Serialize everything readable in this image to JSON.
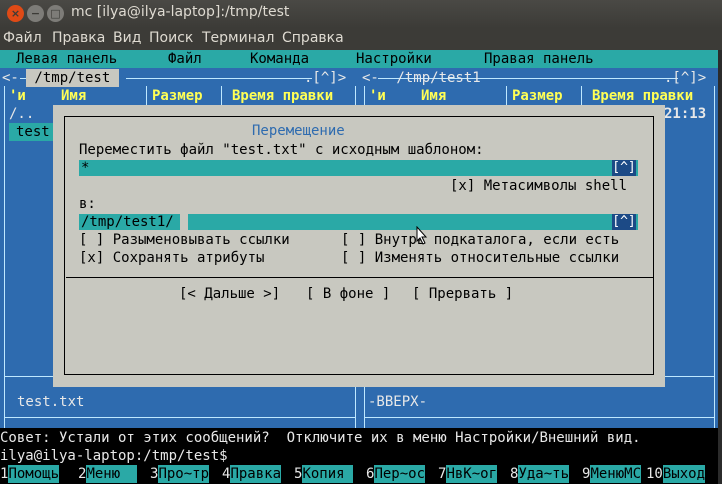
{
  "window": {
    "title": "mc [ilya@ilya-laptop]:/tmp/test"
  },
  "gnome_menu": [
    "Файл",
    "Правка",
    "Вид",
    "Поиск",
    "Терминал",
    "Справка"
  ],
  "mc_menu": [
    "Левая панель",
    "Файл",
    "Команда",
    "Настройки",
    "Правая панель"
  ],
  "left_panel": {
    "path": " /tmp/test ",
    "arrows_left": "<-",
    "arrows_right": ".[^]>",
    "col_sort": "'и",
    "col_name": "Имя",
    "col_size": "Размер",
    "col_time": "Время правки",
    "row1": "/..",
    "row2": "test",
    "footer": "test.txt"
  },
  "right_panel": {
    "path": " /tmp/test1 ",
    "arrows_left": "<-",
    "arrows_right": ".[^]>",
    "col_sort": "'и",
    "col_name": "Имя",
    "col_size": "Размер",
    "col_time": "Время правки",
    "row1_time": "21:13",
    "footer": "-ВВЕРХ-"
  },
  "dialog": {
    "title": "Перемещение",
    "prompt": "Переместить файл \"test.txt\" с исходным шаблоном:",
    "source_value": "*",
    "history_label": "[^]",
    "shell_label": "[x] Метасимволы shell",
    "to_label": "в:",
    "dest_value": "/tmp/test1/",
    "opt_dereference": "[ ] Разыменовывать ссылки",
    "opt_into_subdir": "[ ] Внутрь подкаталога, если есть",
    "opt_preserve": "[x] Сохранять атрибуты",
    "opt_relative": "[ ] Изменять относительные ссылки",
    "btn_continue": "[< Дальше >]",
    "btn_background": "[ В фоне ]",
    "btn_abort": "[ Прервать ]"
  },
  "hint": "Совет: Устали от этих сообщений?  Отключите их в меню Настройки/Внешний вид.",
  "prompt": "ilya@ilya-laptop:/tmp/test$",
  "fkeys": [
    {
      "n": "1",
      "l": "Помощь"
    },
    {
      "n": "2",
      "l": "Меню  "
    },
    {
      "n": "3",
      "l": "Про~тр"
    },
    {
      "n": "4",
      "l": "Правка"
    },
    {
      "n": "5",
      "l": "Копия "
    },
    {
      "n": "6",
      "l": "Пер~ос"
    },
    {
      "n": "7",
      "l": "НвК~ог"
    },
    {
      "n": "8",
      "l": "Уда~ть"
    },
    {
      "n": "9",
      "l": "МенюMC"
    },
    {
      "n": "10",
      "l": "Выход"
    }
  ],
  "colors": {
    "panel_bg": "#2e6baf",
    "accent_cyan": "#2aa9a6",
    "dialog_bg": "#c8c8c0",
    "header_yellow": "#ffff55",
    "close_button": "#df4a16"
  }
}
